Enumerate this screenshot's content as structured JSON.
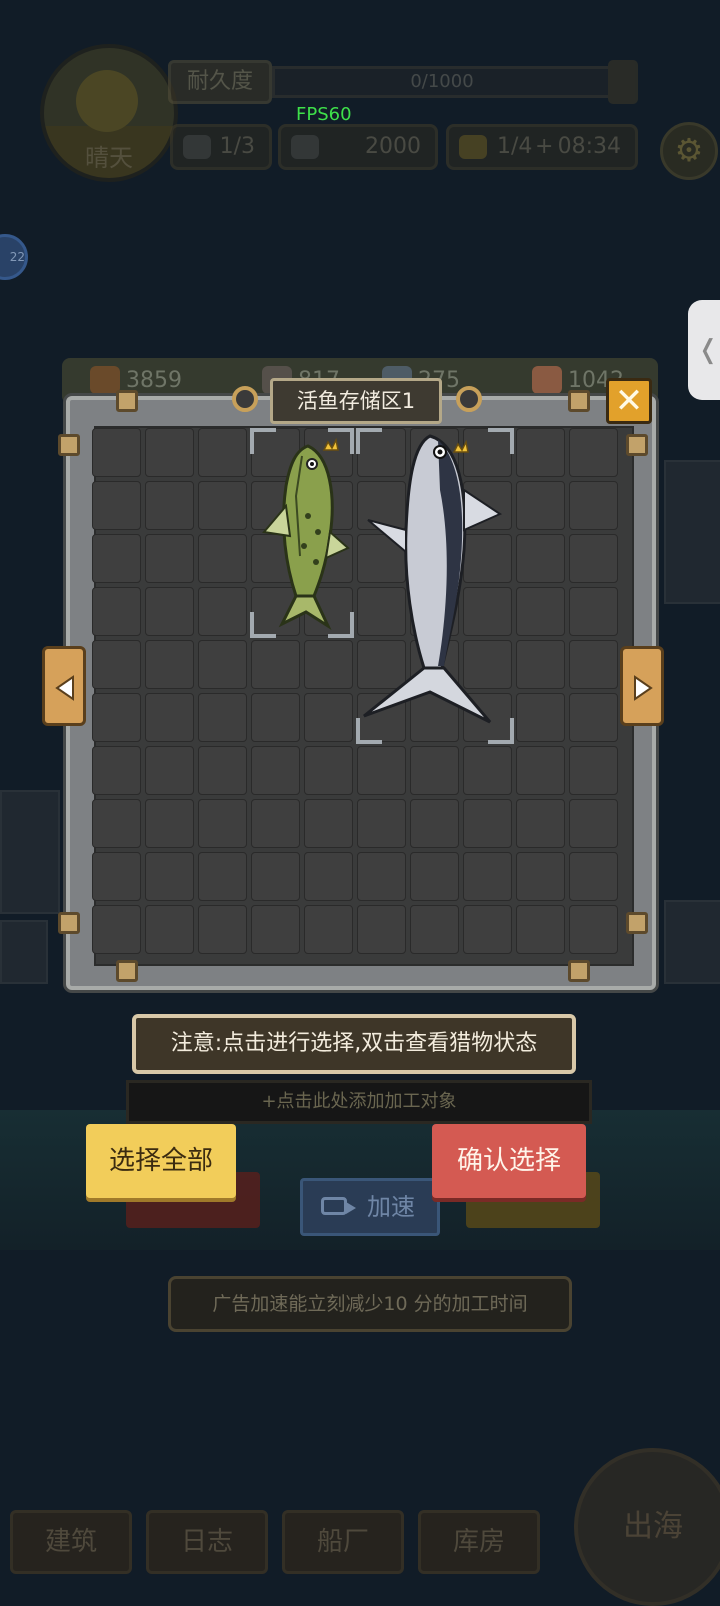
{
  "hud": {
    "weather_label": "晴天",
    "durability_label": "耐久度",
    "durability_value": "0/1000",
    "fps": "FPS60",
    "crew": "1/3",
    "coins": "2000",
    "energy": "1/4",
    "energy_timer": "08:34",
    "energy_plus": "+",
    "level_badge": "22"
  },
  "resources": [
    {
      "icon": "wood-icon",
      "value": "3859"
    },
    {
      "icon": "iron-icon",
      "value": "817"
    },
    {
      "icon": "gear-part-icon",
      "value": "275"
    },
    {
      "icon": "meat-icon",
      "value": "1042"
    }
  ],
  "panel": {
    "title": "活鱼存储区1",
    "grid_rows": 10,
    "grid_cols": 10,
    "notice": "注意:点击进行选择,双击查看猎物状态",
    "select_all": "选择全部",
    "confirm": "确认选择"
  },
  "background": {
    "process_hint": "+点击此处添加加工对象",
    "speed_button": "加速",
    "ad_tip": "广告加速能立刻减少10 分的加工时间",
    "nav": [
      "建筑",
      "日志",
      "船厂",
      "库房"
    ],
    "sail_label": "出海"
  }
}
